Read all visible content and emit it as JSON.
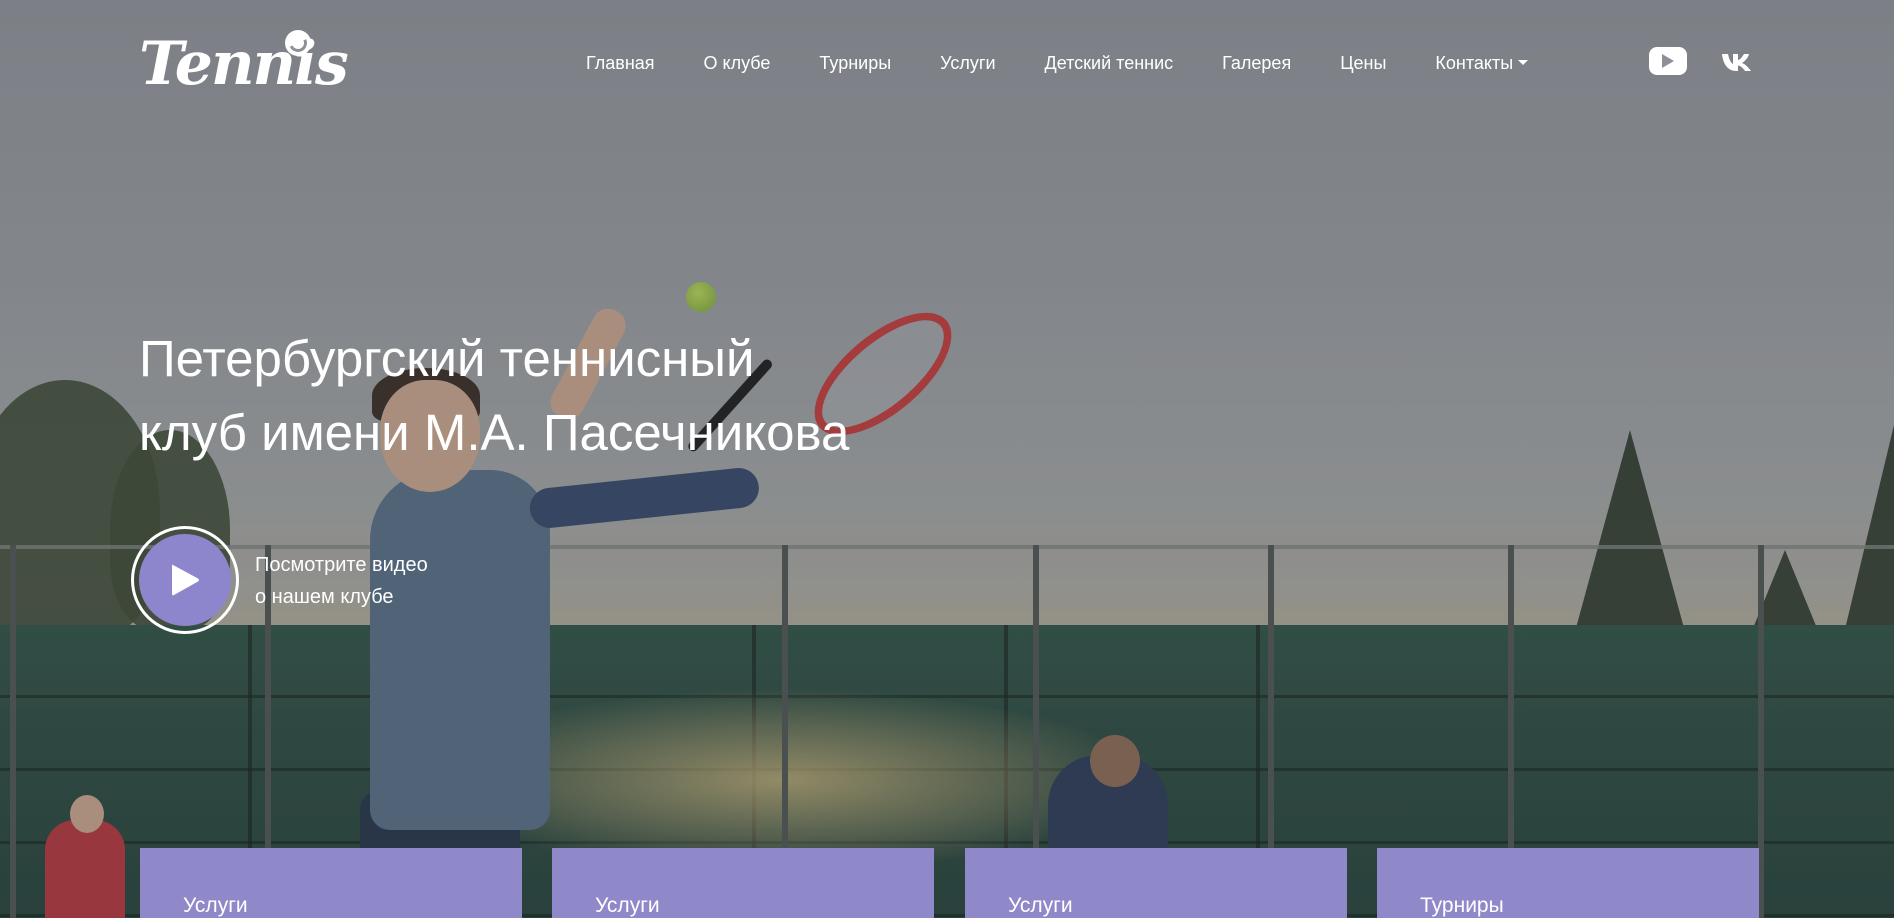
{
  "header": {
    "logo_text": "Tennis",
    "nav": [
      {
        "label": "Главная"
      },
      {
        "label": "О клубе"
      },
      {
        "label": "Турниры"
      },
      {
        "label": "Услуги"
      },
      {
        "label": "Детский теннис"
      },
      {
        "label": "Галерея"
      },
      {
        "label": "Цены"
      },
      {
        "label": "Контакты"
      }
    ],
    "social": [
      {
        "icon": "youtube-icon"
      },
      {
        "icon": "vk-icon"
      }
    ]
  },
  "hero": {
    "title_line1": "Петербургский теннисный",
    "title_line2": "клуб имени М.А. Пасечникова",
    "video_line1": "Посмотрите видео",
    "video_line2": "о нашем клубе"
  },
  "cards": [
    {
      "label": "Услуги"
    },
    {
      "label": "Услуги"
    },
    {
      "label": "Услуги"
    },
    {
      "label": "Турниры"
    }
  ],
  "colors": {
    "accent": "#8f88c9",
    "text": "#ffffff"
  }
}
